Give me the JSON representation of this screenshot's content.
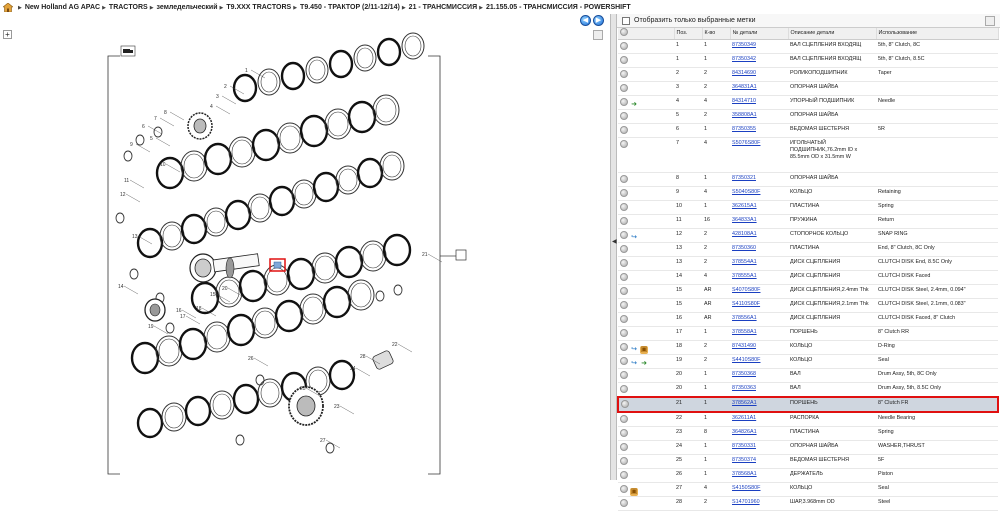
{
  "breadcrumb": [
    "New Holland AG APAC",
    "TRACTORS",
    "земледельческий",
    "T9.XXX TRACTORS",
    "T9.450 - ТРАКТОР (2/11-12/14)",
    "21 - ТРАНСМИССИЯ",
    "21.155.05 - ТРАНСМИССИЯ - POWERSHIFT"
  ],
  "nav": {
    "back": "◀",
    "forward": "▶"
  },
  "filter_label": "Отобразить только выбранные метки",
  "columns": [
    "",
    "Поз.",
    "К-во",
    "№ детали",
    "Описание детали",
    "Использование"
  ],
  "rows": [
    {
      "pos": "1",
      "qty": "1",
      "part": "87350349",
      "desc": "ВАЛ СЦЕПЛЕНИЯ ВХОДЯЩ",
      "use": "5th, 8\" Clutch, 8C",
      "icons": []
    },
    {
      "pos": "1",
      "qty": "1",
      "part": "87350342",
      "desc": "ВАЛ СЦЕПЛЕНИЯ ВХОДЯЩ",
      "use": "5th, 8\" Clutch, 8.5C",
      "icons": []
    },
    {
      "pos": "2",
      "qty": "2",
      "part": "84314690",
      "desc": "РОЛИКОПОДШИПНИК",
      "use": "Taper",
      "icons": []
    },
    {
      "pos": "3",
      "qty": "2",
      "part": "364831A1",
      "desc": "ОПОРНАЯ ШАЙБА",
      "use": "",
      "icons": []
    },
    {
      "pos": "4",
      "qty": "4",
      "part": "84314710",
      "desc": "УПОРНЫЙ ПОДШИПНИК",
      "use": "Needle",
      "icons": [
        "arrow"
      ]
    },
    {
      "pos": "5",
      "qty": "2",
      "part": "358808A1",
      "desc": "ОПОРНАЯ ШАЙБА",
      "use": "",
      "icons": []
    },
    {
      "pos": "6",
      "qty": "1",
      "part": "87350355",
      "desc": "ВЕДОМАЯ ШЕСТЕРНЯ",
      "use": "5R",
      "icons": []
    },
    {
      "pos": "7",
      "qty": "4",
      "part": "S5076S80F",
      "desc": "ИГОЛЬЧАТЫЙ ПОДШИПНИК,76.2mm ID x 85.5mm OD x 31.5mm W",
      "use": "",
      "icons": [],
      "tall": true
    },
    {
      "pos": "8",
      "qty": "1",
      "part": "87350321",
      "desc": "ОПОРНАЯ ШАЙБА",
      "use": "",
      "icons": []
    },
    {
      "pos": "9",
      "qty": "4",
      "part": "S5040S80F",
      "desc": "КОЛЬЦО",
      "use": "Retaining",
      "icons": []
    },
    {
      "pos": "10",
      "qty": "1",
      "part": "362615A1",
      "desc": "ПЛАСТИНА",
      "use": "Spring",
      "icons": []
    },
    {
      "pos": "11",
      "qty": "16",
      "part": "364833A1",
      "desc": "ПРУЖИНА",
      "use": "Return",
      "icons": []
    },
    {
      "pos": "12",
      "qty": "2",
      "part": "428108A1",
      "desc": "СТОПОРНОЕ КОЛЬЦО",
      "use": "SNAP RING",
      "icons": [
        "link"
      ]
    },
    {
      "pos": "13",
      "qty": "2",
      "part": "87350360",
      "desc": "ПЛАСТИНА",
      "use": "End, 8\" Clutch, 8C Only",
      "icons": []
    },
    {
      "pos": "13",
      "qty": "2",
      "part": "378554A1",
      "desc": "ДИСК СЦЕПЛЕНИЯ",
      "use": "CLUTCH DISK End, 8.5C Only",
      "icons": []
    },
    {
      "pos": "14",
      "qty": "4",
      "part": "378555A1",
      "desc": "ДИСК СЦЕПЛЕНИЯ",
      "use": "CLUTCH DISK Faced",
      "icons": []
    },
    {
      "pos": "15",
      "qty": "AR",
      "part": "S4070S80F",
      "desc": "ДИСК СЦЕПЛЕНИЯ,2.4mm Thk",
      "use": "CLUTCH DISK Steel, 2.4mm, 0.094\"",
      "icons": []
    },
    {
      "pos": "15",
      "qty": "AR",
      "part": "S4110S80F",
      "desc": "ДИСК СЦЕПЛЕНИЯ,2.1mm Thk",
      "use": "CLUTCH DISK Steel, 2.1mm, 0.083\"",
      "icons": []
    },
    {
      "pos": "16",
      "qty": "AR",
      "part": "378556A1",
      "desc": "ДИСК СЦЕПЛЕНИЯ",
      "use": "CLUTCH DISK Faced, 8\" Clutch",
      "icons": []
    },
    {
      "pos": "17",
      "qty": "1",
      "part": "378558A1",
      "desc": "ПОРШЕНЬ",
      "use": "8\" Clutch RR",
      "icons": []
    },
    {
      "pos": "18",
      "qty": "2",
      "part": "87431490",
      "desc": "КОЛЬЦО",
      "use": "D-Ring",
      "icons": [
        "link",
        "box"
      ]
    },
    {
      "pos": "19",
      "qty": "2",
      "part": "S4410S80F",
      "desc": "КОЛЬЦО",
      "use": "Seal",
      "icons": [
        "link",
        "arrow"
      ]
    },
    {
      "pos": "20",
      "qty": "1",
      "part": "87350368",
      "desc": "ВАЛ",
      "use": "Drum Assy, 5th, 8C Only",
      "icons": []
    },
    {
      "pos": "20",
      "qty": "1",
      "part": "87350363",
      "desc": "ВАЛ",
      "use": "Drum Assy, 5th, 8.5C Only",
      "icons": []
    },
    {
      "pos": "21",
      "qty": "1",
      "part": "378562A1",
      "desc": "ПОРШЕНЬ",
      "use": "8\" Clutch FR",
      "icons": [],
      "highlight": true
    },
    {
      "pos": "22",
      "qty": "1",
      "part": "362611A1",
      "desc": "РАСПОРКА",
      "use": "Needle Bearing",
      "icons": []
    },
    {
      "pos": "23",
      "qty": "8",
      "part": "364826A1",
      "desc": "ПЛАСТИНА",
      "use": "Spring",
      "icons": []
    },
    {
      "pos": "24",
      "qty": "1",
      "part": "87350331",
      "desc": "ОПОРНАЯ ШАЙБА",
      "use": "WASHER,THRUST",
      "icons": []
    },
    {
      "pos": "25",
      "qty": "1",
      "part": "87350374",
      "desc": "ВЕДОМАЯ ШЕСТЕРНЯ",
      "use": "5F",
      "icons": []
    },
    {
      "pos": "26",
      "qty": "1",
      "part": "378568A1",
      "desc": "ДЕРЖАТЕЛЬ",
      "use": "Piston",
      "icons": []
    },
    {
      "pos": "27",
      "qty": "4",
      "part": "S4150S80F",
      "desc": "КОЛЬЦО",
      "use": "Seal",
      "icons": [
        "box"
      ]
    },
    {
      "pos": "28",
      "qty": "2",
      "part": "S14701960",
      "desc": "ШАР,3.968mm OD",
      "use": "Steel",
      "icons": []
    }
  ],
  "diagram_callouts": [
    "1",
    "2",
    "3",
    "4",
    "5",
    "6",
    "7",
    "8",
    "9",
    "10",
    "11",
    "12",
    "13",
    "14",
    "15",
    "16",
    "17",
    "18",
    "19",
    "20",
    "21",
    "22",
    "23",
    "24",
    "25",
    "26",
    "27",
    "28"
  ]
}
